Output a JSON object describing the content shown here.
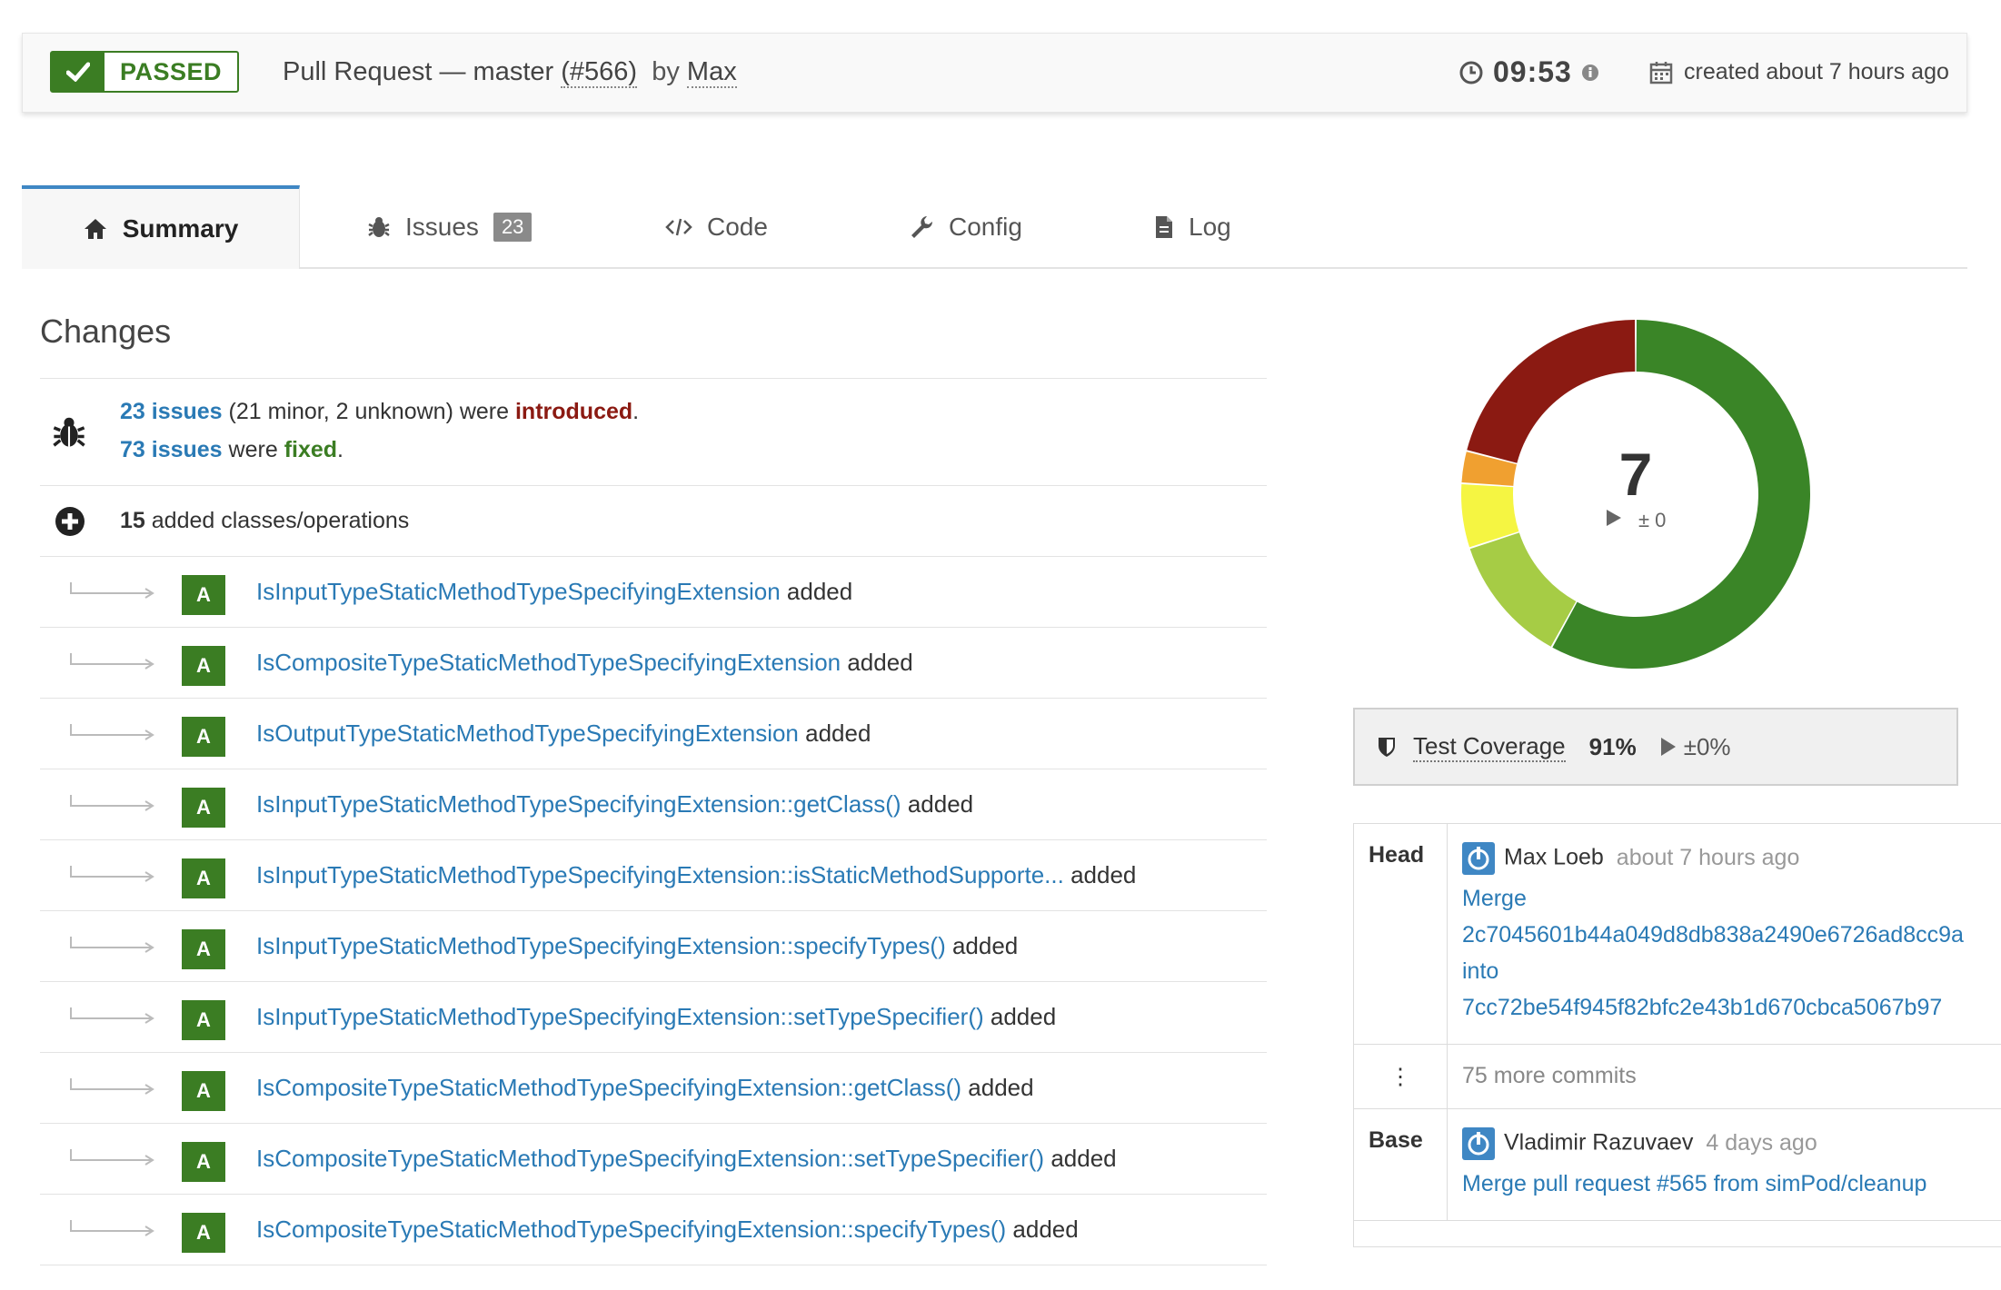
{
  "header": {
    "status": "PASSED",
    "title_prefix": "Pull Request — ",
    "branch": "master",
    "pr_number": "(#566)",
    "by": "by",
    "author": "Max",
    "duration": "09:53",
    "created": "created about 7 hours ago"
  },
  "tabs": [
    {
      "label": "Summary",
      "icon": "home-icon"
    },
    {
      "label": "Issues",
      "icon": "bug-icon",
      "count": "23"
    },
    {
      "label": "Code",
      "icon": "code-icon"
    },
    {
      "label": "Config",
      "icon": "wrench-icon"
    },
    {
      "label": "Log",
      "icon": "file-icon"
    }
  ],
  "changes": {
    "title": "Changes",
    "issues_introduced_link": "23 issues",
    "issues_introduced_detail": " (21 minor, 2 unknown) were ",
    "introduced_word": "introduced",
    "issues_fixed_link": "73 issues",
    "issues_fixed_detail": " were ",
    "fixed_word": "fixed",
    "classes_count": "15",
    "classes_text": " added classes/operations",
    "added_badge": "A",
    "added_suffix": " added",
    "items": [
      "IsInputTypeStaticMethodTypeSpecifyingExtension",
      "IsCompositeTypeStaticMethodTypeSpecifyingExtension",
      "IsOutputTypeStaticMethodTypeSpecifyingExtension",
      "IsInputTypeStaticMethodTypeSpecifyingExtension::getClass()",
      "IsInputTypeStaticMethodTypeSpecifyingExtension::isStaticMethodSupporte...",
      "IsInputTypeStaticMethodTypeSpecifyingExtension::specifyTypes()",
      "IsInputTypeStaticMethodTypeSpecifyingExtension::setTypeSpecifier()",
      "IsCompositeTypeStaticMethodTypeSpecifyingExtension::getClass()",
      "IsCompositeTypeStaticMethodTypeSpecifyingExtension::setTypeSpecifier()",
      "IsCompositeTypeStaticMethodTypeSpecifyingExtension::specifyTypes()"
    ]
  },
  "quality": {
    "score": "7",
    "delta": "± 0",
    "segments": [
      {
        "color": "#3a8527",
        "fraction": 0.58
      },
      {
        "color": "#a6cc45",
        "fraction": 0.12
      },
      {
        "color": "#f5f542",
        "fraction": 0.06
      },
      {
        "color": "#f0a030",
        "fraction": 0.03
      },
      {
        "color": "#8b1a12",
        "fraction": 0.21
      }
    ]
  },
  "coverage": {
    "label": "Test Coverage",
    "percent": "91%",
    "delta": "±0%"
  },
  "commits": {
    "head_label": "Head",
    "head_author": "Max Loeb",
    "head_ago": "about 7 hours ago",
    "head_msg_1": "Merge",
    "head_msg_2": "2c7045601b44a049d8db838a2490e6726ad8cc9a",
    "head_msg_3": "into",
    "head_msg_4": "7cc72be54f945f82bfc2e43b1d670cbca5067b97",
    "more": "75 more commits",
    "more_key": "⋮",
    "base_label": "Base",
    "base_author": "Vladimir Razuvaev",
    "base_ago": "4 days ago",
    "base_msg": "Merge pull request #565 from simPod/cleanup"
  }
}
